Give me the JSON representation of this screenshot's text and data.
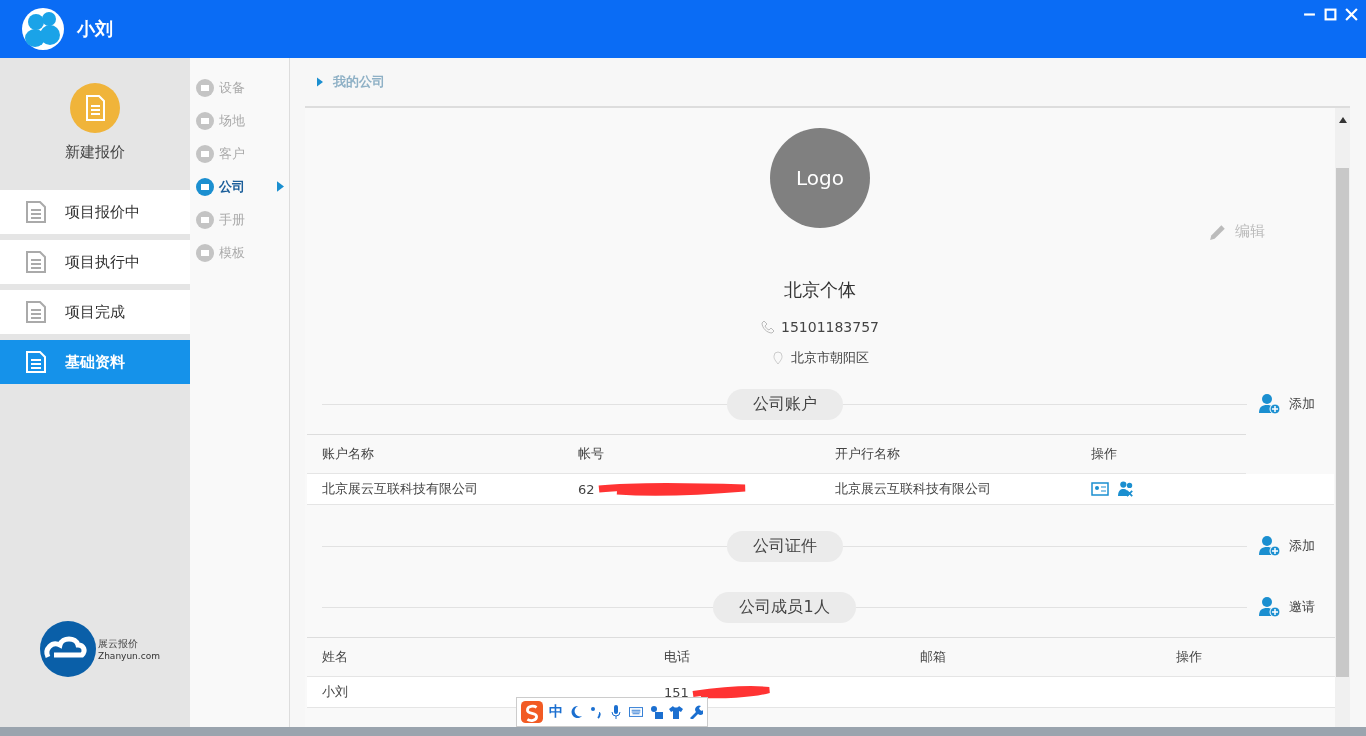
{
  "header": {
    "title": "小刘"
  },
  "new_quote": {
    "label": "新建报价"
  },
  "nav": [
    {
      "label": "项目报价中",
      "selected": false
    },
    {
      "label": "项目执行中",
      "selected": false
    },
    {
      "label": "项目完成",
      "selected": false
    },
    {
      "label": "基础资料",
      "selected": true
    }
  ],
  "brand": {
    "name": "展云报价",
    "domain": "Zhanyun.com"
  },
  "subnav": [
    {
      "label": "设备",
      "selected": false
    },
    {
      "label": "场地",
      "selected": false
    },
    {
      "label": "客户",
      "selected": false
    },
    {
      "label": "公司",
      "selected": true
    },
    {
      "label": "手册",
      "selected": false
    },
    {
      "label": "模板",
      "selected": false
    }
  ],
  "breadcrumb": "我的公司",
  "company": {
    "logo": "Logo",
    "edit": "编辑",
    "name": "北京个体",
    "phone": "15101183757",
    "address": "北京市朝阳区"
  },
  "accounts": {
    "title": "公司账户",
    "action": "添加",
    "columns": [
      "账户名称",
      "帐号",
      "开户行名称",
      "操作"
    ],
    "rows": [
      {
        "name": "北京展云互联科技有限公司",
        "number": "62",
        "bank": "北京展云互联科技有限公司"
      }
    ]
  },
  "certificates": {
    "title": "公司证件",
    "action": "添加"
  },
  "members": {
    "title": "公司成员1人",
    "action": "邀请",
    "columns": [
      "姓名",
      "电话",
      "邮箱",
      "操作"
    ],
    "rows": [
      {
        "name": "小刘",
        "phone": "151"
      }
    ]
  },
  "ime_bar": {
    "mode": "中"
  }
}
